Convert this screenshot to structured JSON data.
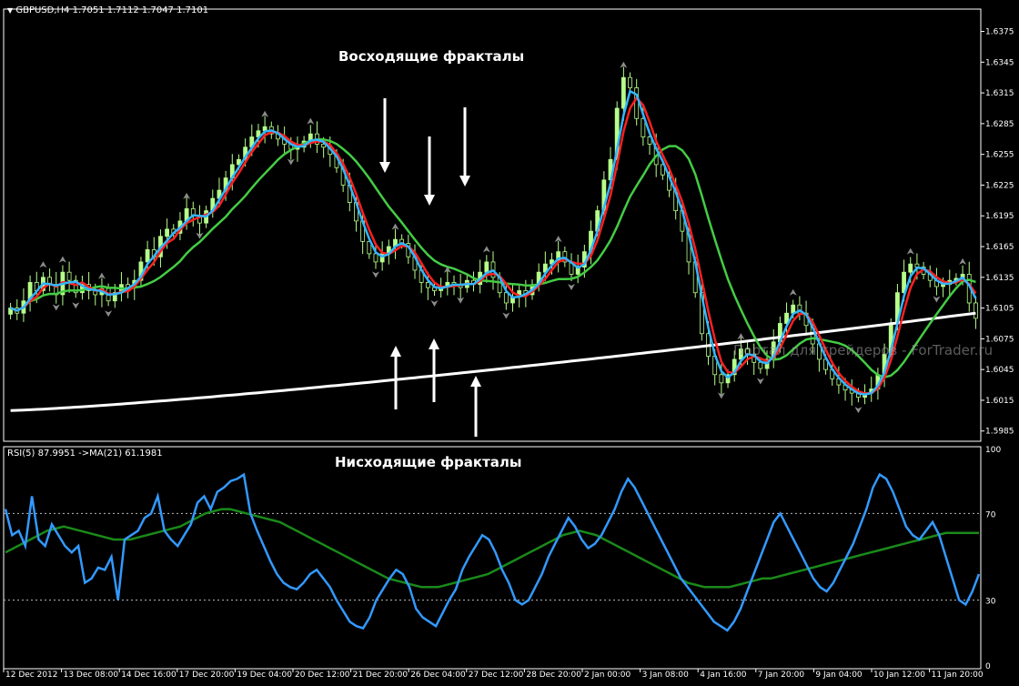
{
  "chart_data": [
    {
      "type": "candlestick",
      "header": "GBPUSD,H4  1.7051 1.7112 1.7047 1.7101",
      "symbol": "GBPUSD",
      "timeframe": "H4",
      "last_ohlc": [
        1.7051,
        1.7112,
        1.7047,
        1.7101
      ],
      "ylim": [
        1.5975,
        1.6395
      ],
      "yticks": [
        "1.6375",
        "1.6345",
        "1.6315",
        "1.6285",
        "1.6255",
        "1.6225",
        "1.6195",
        "1.6165",
        "1.6135",
        "1.6105",
        "1.6075",
        "1.6045",
        "1.6015",
        "1.5985"
      ],
      "xticks": [
        "12 Dec 2012",
        "13 Dec 08:00",
        "14 Dec 16:00",
        "17 Dec 20:00",
        "19 Dec 04:00",
        "20 Dec 12:00",
        "21 Dec 20:00",
        "26 Dec 04:00",
        "27 Dec 12:00",
        "28 Dec 20:00",
        "2 Jan 00:00",
        "3 Jan 08:00",
        "4 Jan 16:00",
        "7 Jan 20:00",
        "9 Jan 04:00",
        "10 Jan 12:00",
        "11 Jan 20:00"
      ],
      "annotations": {
        "up_fractals": "Восходящие фракталы",
        "down_fractals": "Нисходящие фракталы",
        "watermark": "Портал для трейдеров - ForTrader.ru"
      },
      "close": [
        1.6105,
        1.61,
        1.6112,
        1.613,
        1.6122,
        1.6135,
        1.6128,
        1.6118,
        1.614,
        1.6132,
        1.612,
        1.6128,
        1.6122,
        1.6118,
        1.6124,
        1.6112,
        1.612,
        1.6128,
        1.6125,
        1.6132,
        1.615,
        1.6162,
        1.6155,
        1.6175,
        1.6182,
        1.6178,
        1.619,
        1.6202,
        1.6195,
        1.6188,
        1.62,
        1.6212,
        1.622,
        1.6232,
        1.6245,
        1.625,
        1.6262,
        1.6272,
        1.6278,
        1.6282,
        1.6275,
        1.627,
        1.6265,
        1.626,
        1.6262,
        1.6268,
        1.6275,
        1.6265,
        1.6262,
        1.6255,
        1.6242,
        1.6225,
        1.6208,
        1.619,
        1.617,
        1.6158,
        1.615,
        1.6158,
        1.6165,
        1.6172,
        1.6168,
        1.6155,
        1.6142,
        1.613,
        1.6125,
        1.6122,
        1.6126,
        1.613,
        1.6128,
        1.6125,
        1.6132,
        1.6128,
        1.614,
        1.615,
        1.6135,
        1.612,
        1.611,
        1.6116,
        1.6122,
        1.6118,
        1.6128,
        1.614,
        1.6148,
        1.6152,
        1.616,
        1.615,
        1.6138,
        1.6145,
        1.616,
        1.618,
        1.62,
        1.623,
        1.625,
        1.63,
        1.633,
        1.632,
        1.629,
        1.6272,
        1.6265,
        1.6245,
        1.6235,
        1.622,
        1.62,
        1.618,
        1.615,
        1.612,
        1.608,
        1.6058,
        1.604,
        1.6032,
        1.604,
        1.6055,
        1.6065,
        1.606,
        1.6052,
        1.6046,
        1.6055,
        1.6072,
        1.609,
        1.61,
        1.6108,
        1.61,
        1.6088,
        1.607,
        1.6055,
        1.6045,
        1.6036,
        1.603,
        1.6025,
        1.6022,
        1.6018,
        1.6022,
        1.6026,
        1.604,
        1.606,
        1.609,
        1.612,
        1.614,
        1.6148,
        1.6145,
        1.6138,
        1.6132,
        1.6126,
        1.6128,
        1.6132,
        1.6134,
        1.6138,
        1.611,
        1.6095
      ]
    },
    {
      "type": "line",
      "header": "RSI(5) 87.9951  ->MA(21) 61.1981",
      "series": [
        {
          "name": "RSI(5)",
          "last": 87.9951,
          "values": [
            72,
            60,
            62,
            55,
            78,
            58,
            55,
            65,
            60,
            55,
            52,
            55,
            38,
            40,
            45,
            44,
            50,
            30,
            58,
            60,
            62,
            68,
            70,
            78,
            62,
            58,
            55,
            60,
            65,
            75,
            78,
            72,
            80,
            82,
            85,
            86,
            88,
            70,
            62,
            55,
            48,
            42,
            38,
            36,
            35,
            38,
            42,
            44,
            40,
            36,
            30,
            25,
            20,
            18,
            17,
            22,
            30,
            35,
            40,
            44,
            42,
            36,
            26,
            22,
            20,
            18,
            24,
            30,
            35,
            44,
            50,
            55,
            60,
            58,
            52,
            44,
            38,
            30,
            28,
            30,
            36,
            42,
            50,
            56,
            62,
            68,
            64,
            58,
            54,
            56,
            60,
            66,
            72,
            80,
            86,
            82,
            76,
            70,
            64,
            58,
            52,
            46,
            40,
            36,
            32,
            28,
            24,
            20,
            18,
            16,
            20,
            26,
            34,
            42,
            50,
            58,
            66,
            70,
            64,
            58,
            52,
            46,
            40,
            36,
            34,
            38,
            44,
            50,
            56,
            64,
            72,
            82,
            88,
            86,
            80,
            72,
            64,
            60,
            58,
            62,
            66,
            60,
            50,
            40,
            30,
            28,
            34,
            42
          ]
        },
        {
          "name": "MA(21)",
          "last": 61.1981,
          "values": [
            52,
            54,
            56,
            58,
            60,
            62,
            63,
            64,
            63,
            62,
            61,
            60,
            59,
            58,
            58,
            58,
            59,
            60,
            61,
            62,
            63,
            64,
            66,
            68,
            70,
            71,
            72,
            72,
            71,
            70,
            69,
            68,
            67,
            66,
            64,
            62,
            60,
            58,
            56,
            54,
            52,
            50,
            48,
            46,
            44,
            42,
            40,
            39,
            38,
            37,
            36,
            36,
            36,
            37,
            38,
            39,
            40,
            41,
            42,
            44,
            46,
            48,
            50,
            52,
            54,
            56,
            58,
            60,
            61,
            62,
            61,
            60,
            58,
            56,
            54,
            52,
            50,
            48,
            46,
            44,
            42,
            40,
            38,
            37,
            36,
            36,
            36,
            36,
            37,
            38,
            39,
            40,
            40,
            41,
            42,
            43,
            44,
            45,
            46,
            47,
            48,
            49,
            50,
            51,
            52,
            53,
            54,
            55,
            56,
            57,
            58,
            59,
            60,
            61,
            61,
            61,
            61,
            61
          ]
        }
      ],
      "ylim": [
        0,
        100
      ],
      "yticks": [
        "100",
        "70",
        "30",
        "0"
      ],
      "levels": [
        70,
        30
      ]
    }
  ],
  "colors": {
    "bg": "#000000",
    "frame": "#ffffff",
    "bull_candle": "#b6ff8a",
    "bear_candle": "#000000",
    "ma_fast": "#33b5ff",
    "ma_mid": "#ff2020",
    "ma_slow": "#44cc44",
    "ma_long": "#ffffff",
    "rsi": "#3399ff",
    "rsi_ma": "#1a8a1a",
    "fractal": "#8c8c8c",
    "arrow": "#ffffff"
  }
}
